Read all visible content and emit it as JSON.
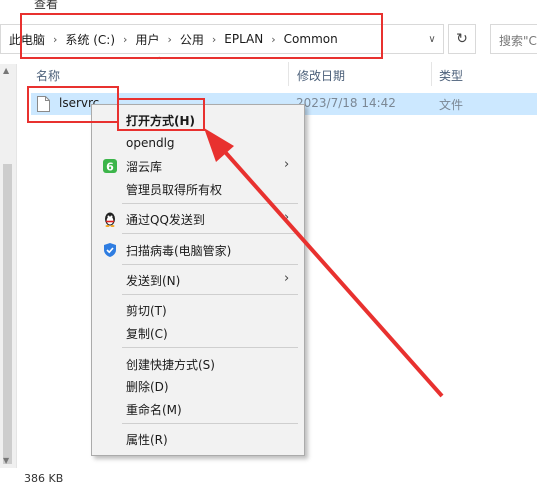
{
  "ribbon": {
    "tab_view": "查看"
  },
  "address_bar": {
    "crumbs": [
      "此电脑",
      "系统 (C:)",
      "用户",
      "公用",
      "EPLAN",
      "Common"
    ],
    "separator": "›",
    "dropdown_icon": "chevron-down-icon",
    "refresh_icon": "refresh-icon"
  },
  "search": {
    "placeholder": "搜索\"Co"
  },
  "columns": {
    "name": "名称",
    "modified": "修改日期",
    "type": "类型"
  },
  "files": [
    {
      "name": "lservrc",
      "modified": "2023/7/18 14:42",
      "type": "文件"
    }
  ],
  "status": {
    "text": "386 KB"
  },
  "context_menu": {
    "open_with": "打开方式(H)",
    "opendlg": "opendlg",
    "liuyunku": "溜云库",
    "take_ownership": "管理员取得所有权",
    "send_qq": "通过QQ发送到",
    "scan_virus": "扫描病毒(电脑管家)",
    "send_to": "发送到(N)",
    "cut": "剪切(T)",
    "copy": "复制(C)",
    "create_shortcut": "创建快捷方式(S)",
    "delete": "删除(D)",
    "rename": "重命名(M)",
    "properties": "属性(R)"
  },
  "colors": {
    "selection": "#cce8ff",
    "highlight_red": "#e8312f",
    "menu_bg": "#f2f2f2"
  }
}
